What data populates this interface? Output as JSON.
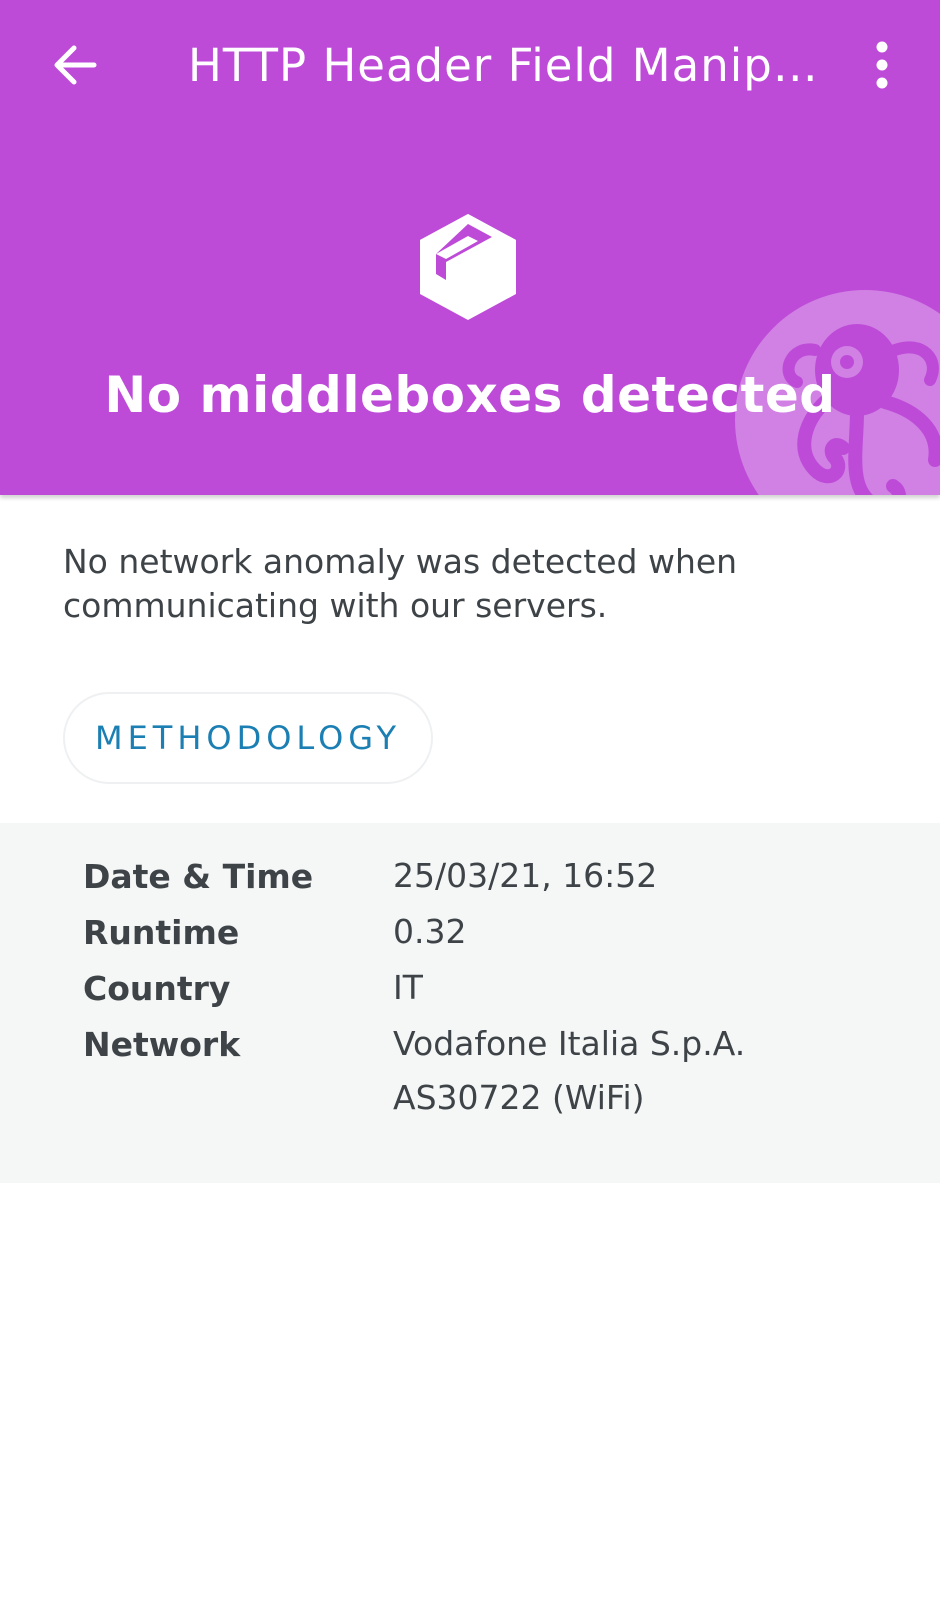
{
  "colors": {
    "header_bg": "#bd4bd8",
    "text": "#3e4348",
    "accent": "#1b7fb3",
    "panel_bg": "#f5f6f6"
  },
  "toolbar": {
    "back_icon": "arrow-left-icon",
    "title": "HTTP Header Field Manipulation",
    "menu_icon": "more-vertical-icon"
  },
  "hero": {
    "icon": "middlebox-cube-icon",
    "title": "No middleboxes detected"
  },
  "description": "No network anomaly was detected when communicating with our servers.",
  "methodology_label": "METHODOLOGY",
  "details": [
    {
      "label": "Date & Time",
      "value": "25/03/21, 16:52"
    },
    {
      "label": "Runtime",
      "value": "0.32"
    },
    {
      "label": "Country",
      "value": "IT"
    },
    {
      "label": "Network",
      "value": "Vodafone Italia S.p.A.\nAS30722 (WiFi)"
    }
  ]
}
